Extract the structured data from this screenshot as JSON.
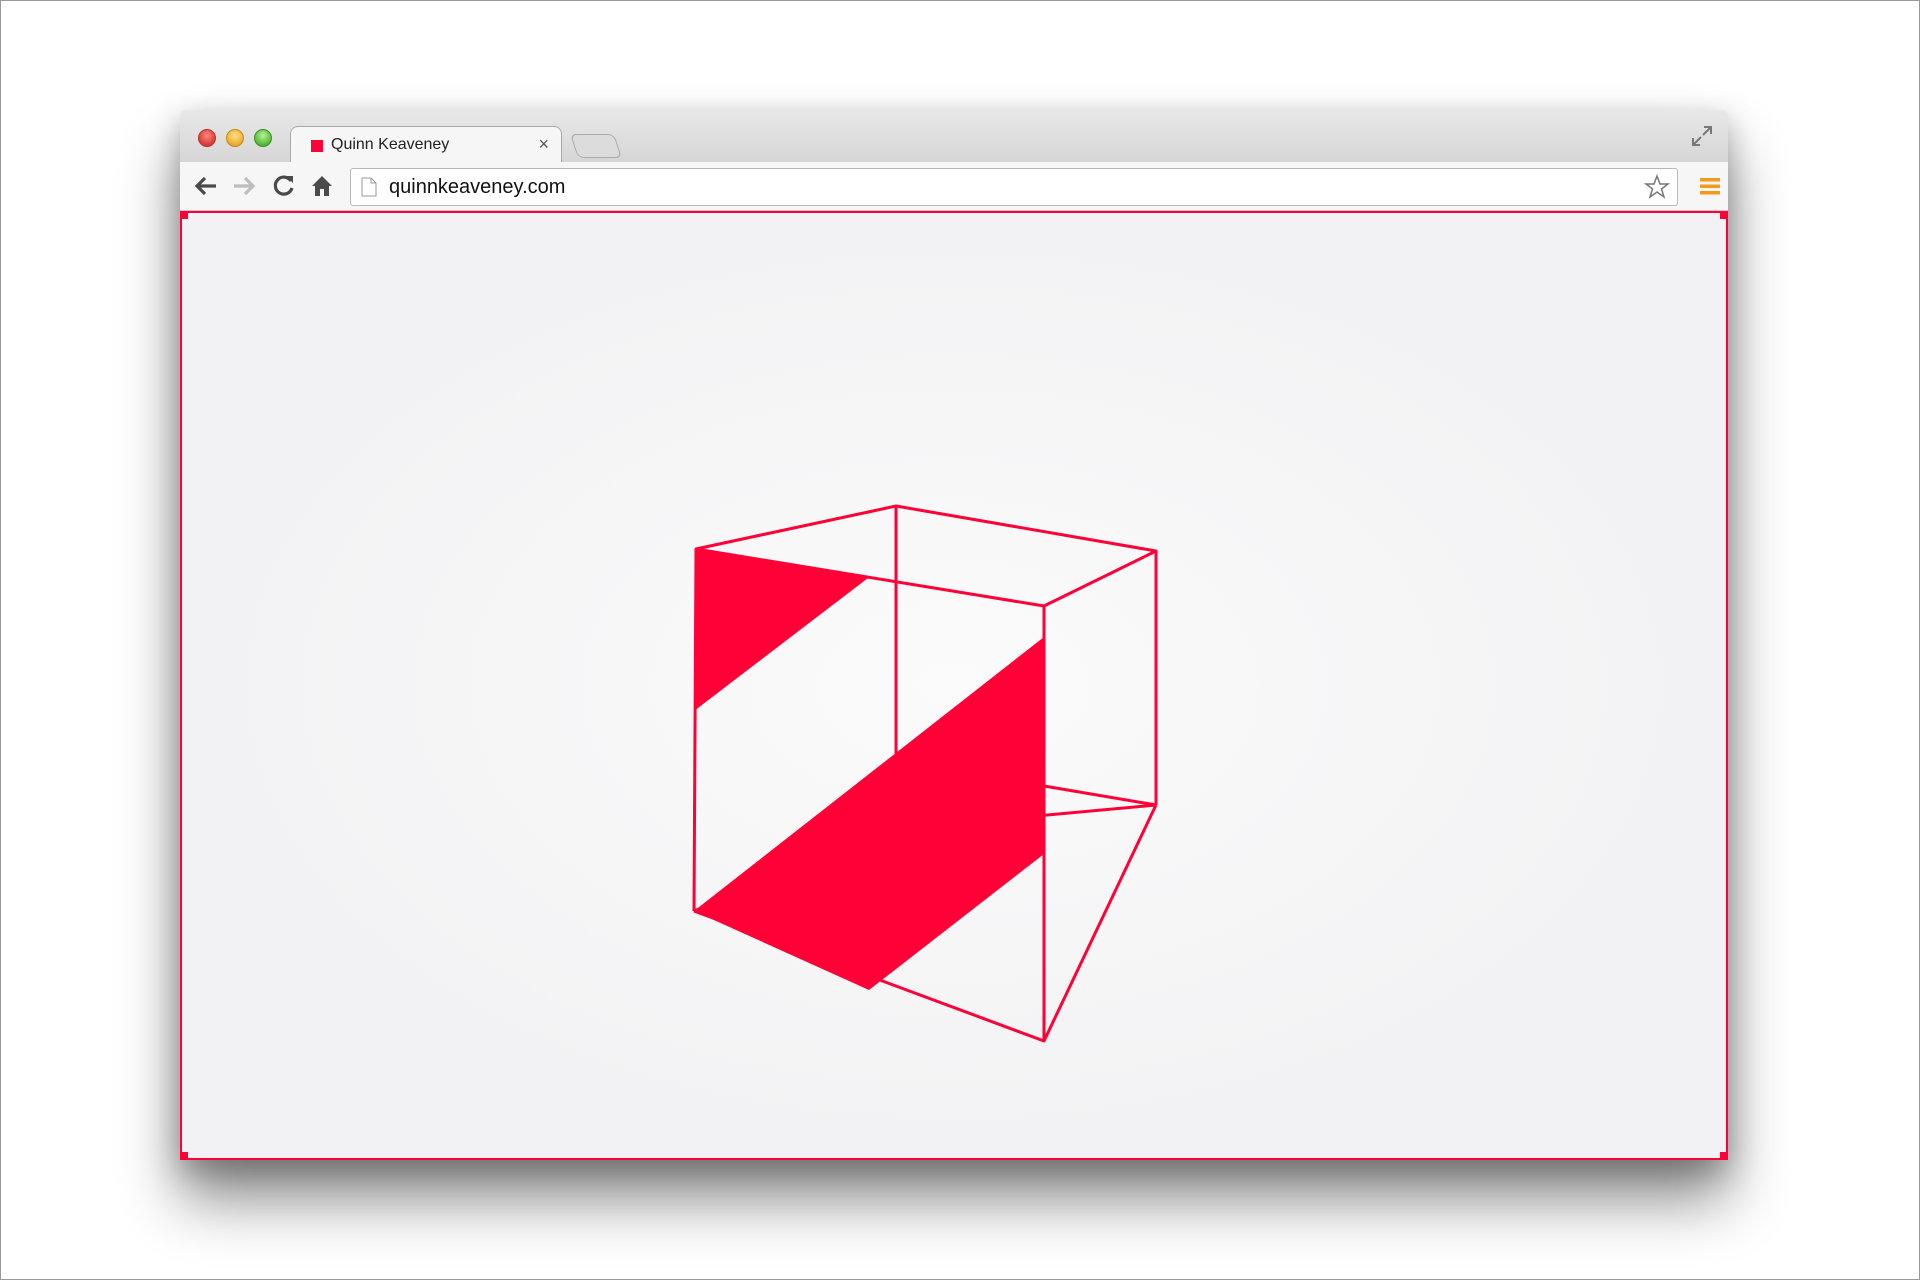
{
  "tab": {
    "title": "Quinn Keaveney",
    "close_glyph": "×"
  },
  "address_bar": {
    "url": "quinnkeaveney.com"
  },
  "colors": {
    "accent": "#ff0037",
    "menu": "#f29a1c"
  },
  "icons": {
    "back": "back-arrow-icon",
    "forward": "forward-arrow-icon",
    "reload": "reload-icon",
    "home": "home-icon",
    "bookmark": "star-icon",
    "menu": "hamburger-menu-icon",
    "fullscreen": "fullscreen-icon",
    "page": "page-icon",
    "logo": "cube-logo"
  }
}
